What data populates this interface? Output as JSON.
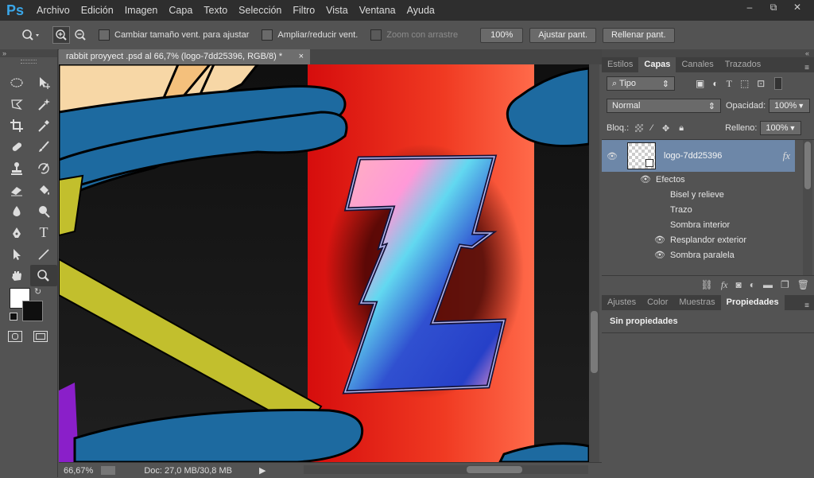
{
  "menubar": {
    "logo": "Ps",
    "items": [
      "Archivo",
      "Edición",
      "Imagen",
      "Capa",
      "Texto",
      "Selección",
      "Filtro",
      "Vista",
      "Ventana",
      "Ayuda"
    ],
    "controls": [
      "–",
      "⧉",
      "✕"
    ]
  },
  "options": {
    "resize_windows": "Cambiar tamaño vent. para ajustar",
    "zoom_all": "Ampliar/reducir vent.",
    "scrubby_zoom": "Zoom con arrastre",
    "zoom_pct": "100%",
    "fit_screen": "Ajustar pant.",
    "fill_screen": "Rellenar pant."
  },
  "document": {
    "tab_title": "rabbit proyyect .psd al 66,7% (logo-7dd25396, RGB/8) *",
    "close": "×",
    "zoom": "66,67%",
    "doc_size": "Doc: 27,0 MB/30,8 MB"
  },
  "layers_panel": {
    "tabs": [
      "Estilos",
      "Capas",
      "Canales",
      "Trazados"
    ],
    "active_tab": "Capas",
    "filter_label": "Tipo",
    "blend_mode": "Normal",
    "opacity_label": "Opacidad:",
    "opacity_value": "100%",
    "lock_label": "Bloq.:",
    "fill_label": "Relleno:",
    "fill_value": "100%",
    "layer_name": "logo-7dd25396",
    "fx_label": "fx",
    "effects_label": "Efectos",
    "effects": [
      {
        "name": "Bisel y relieve",
        "visible": false
      },
      {
        "name": "Trazo",
        "visible": false
      },
      {
        "name": "Sombra interior",
        "visible": false
      },
      {
        "name": "Resplandor exterior",
        "visible": true
      },
      {
        "name": "Sombra paralela",
        "visible": true
      }
    ]
  },
  "properties_panel": {
    "tabs": [
      "Ajustes",
      "Color",
      "Muestras",
      "Propiedades"
    ],
    "active_tab": "Propiedades",
    "content": "Sin propiedades"
  },
  "colors": {
    "menubar_bg": "#2e2e2e",
    "panel_bg": "#535353",
    "selected_layer": "#6d87a8",
    "accent": "#3aa6e8"
  }
}
